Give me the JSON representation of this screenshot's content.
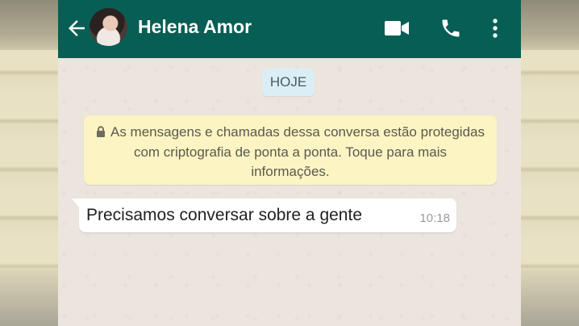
{
  "header": {
    "contact_name": "Helena Amor",
    "back_icon": "arrow-left-icon",
    "video_icon": "video-camera-icon",
    "call_icon": "phone-icon",
    "menu_icon": "more-vertical-icon",
    "bar_color": "#075e54"
  },
  "chat": {
    "date_label": "HOJE",
    "encryption_notice": "As mensagens e chamadas dessa conversa estão protegidas com criptografia de ponta a ponta. Toque para mais informações.",
    "messages": [
      {
        "text": "Precisamos conversar sobre a gente",
        "time": "10:18",
        "direction": "incoming"
      }
    ]
  }
}
